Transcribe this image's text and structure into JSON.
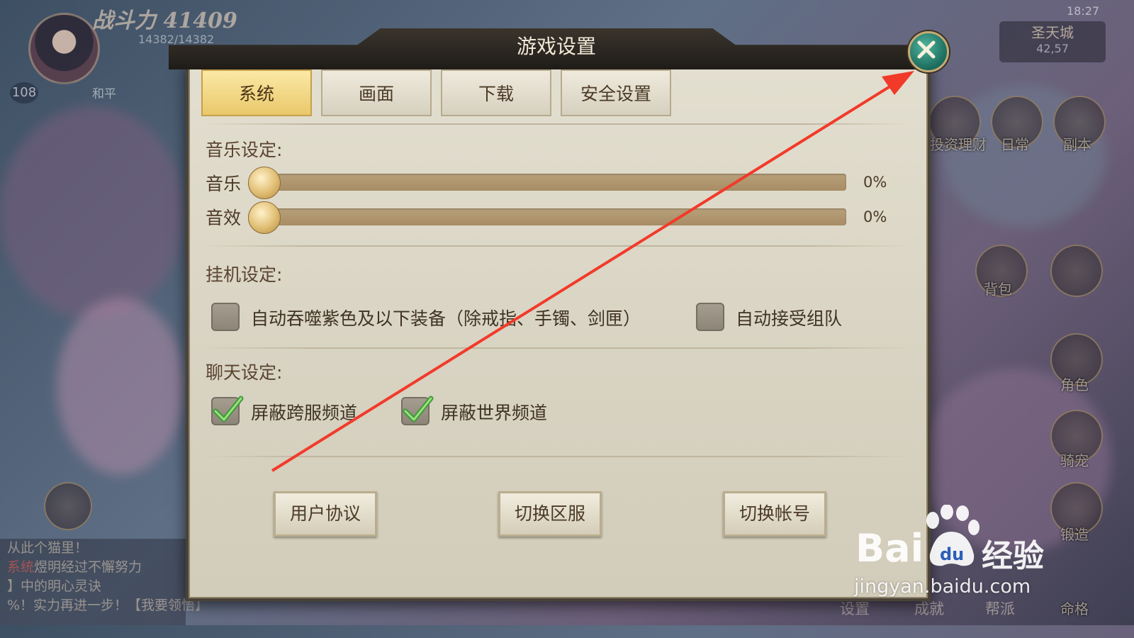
{
  "hud": {
    "power": "战斗力 41409",
    "hp": "14382/14382",
    "level": "108",
    "mode": "和平",
    "city": "圣天城",
    "coords": "42,57",
    "time": "18:27",
    "side_buttons": [
      "投资理财",
      "日常",
      "副本",
      "背包",
      "角色",
      "骑宠",
      "锻造",
      "命格"
    ],
    "bottom_buttons": [
      "设置",
      "成就",
      "帮派"
    ],
    "chat_lines": [
      {
        "channel": "",
        "text": "从此个猫里！"
      },
      {
        "channel": "系统",
        "text": "煜明经过不懈努力"
      },
      {
        "channel": "",
        "text": "】中的明心灵诀"
      },
      {
        "channel": "",
        "text": "%！实力再进一步！【我要领悟】"
      }
    ]
  },
  "dialog": {
    "title": "游戏设置",
    "tabs": [
      {
        "label": "系统",
        "active": true
      },
      {
        "label": "画面",
        "active": false
      },
      {
        "label": "下载",
        "active": false
      },
      {
        "label": "安全设置",
        "active": false
      }
    ],
    "music": {
      "title": "音乐设定:",
      "sliders": [
        {
          "label": "音乐",
          "value": "0%",
          "level": 0
        },
        {
          "label": "音效",
          "value": "0%",
          "level": 0
        }
      ]
    },
    "idle": {
      "title": "挂机设定:",
      "options": [
        {
          "label": "自动吞噬紫色及以下装备（除戒指、手镯、剑匣）",
          "checked": false
        },
        {
          "label": "自动接受组队",
          "checked": false
        }
      ]
    },
    "chat": {
      "title": "聊天设定:",
      "options": [
        {
          "label": "屏蔽跨服频道",
          "checked": true
        },
        {
          "label": "屏蔽世界频道",
          "checked": true
        }
      ]
    },
    "buttons": [
      "用户协议",
      "切换区服",
      "切换帐号"
    ]
  },
  "watermark": {
    "logo": "Bai",
    "logo_suffix": "经验",
    "url": "jingyan.baidu.com"
  },
  "colors": {
    "annotation_arrow": "#f23a2a",
    "active_tab": "#e9c86a",
    "close_button": "#1c6b5c"
  }
}
